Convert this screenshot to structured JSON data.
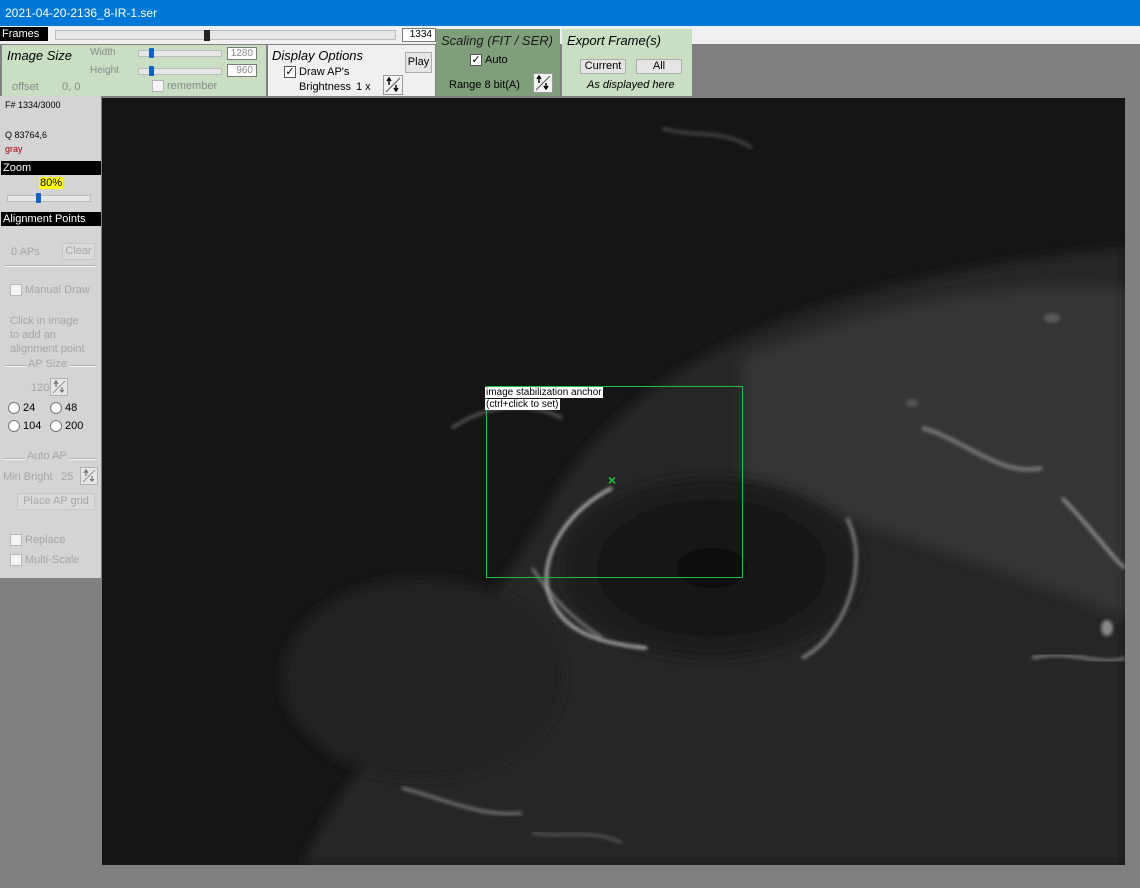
{
  "window": {
    "title": "2021-04-20-2136_8-IR-1.ser"
  },
  "frames": {
    "label": "Frames",
    "value": "1334",
    "position": 0.4446
  },
  "image_size": {
    "title": "Image Size",
    "width_label": "Width",
    "width_value": "1280",
    "height_label": "Height",
    "height_value": "960",
    "remember_label": "remember",
    "offset_label": "offset",
    "offset_value": "0, 0"
  },
  "display_options": {
    "title": "Display Options",
    "draw_aps_label": "Draw AP's",
    "draw_aps_checked": true,
    "brightness_label": "Brightness",
    "brightness_value": "1 x",
    "play_label": "Play"
  },
  "scaling": {
    "title": "Scaling (FIT / SER)",
    "auto_label": "Auto",
    "auto_checked": true,
    "range_label": "Range 8 bit(A)"
  },
  "export": {
    "title": "Export Frame(s)",
    "current_label": "Current",
    "all_label": "All",
    "note": "As displayed here"
  },
  "info": {
    "frame_text": "F# 1334/3000",
    "quality_text": "Q  83764,6",
    "color_text": "gray"
  },
  "zoom": {
    "header": "Zoom",
    "value": "80%"
  },
  "alignment": {
    "header": "Alignment Points",
    "aps_count": "0 APs",
    "clear_label": "Clear",
    "manual_draw_label": "Manual Draw",
    "hint_lines": [
      "Click in image",
      "to add an",
      "alignment point"
    ],
    "ap_size_header": "AP Size",
    "ap_size_value": "120",
    "size_options": [
      "24",
      "48",
      "104",
      "200"
    ],
    "auto_ap_header": "Auto AP",
    "min_bright_label": "Min Bright",
    "min_bright_value": "25",
    "place_grid_label": "Place AP grid",
    "replace_label": "Replace",
    "multiscale_label": "Multi-Scale"
  },
  "anchor": {
    "line1": "image stabilization anchor",
    "line2": "(ctrl+click to set)",
    "marker": "×"
  },
  "colors": {
    "titlebar": "#0078d7",
    "panel_green": "#c9dec2",
    "anchor_green": "#22c03a",
    "zoom_highlight": "#ffff00",
    "gray_text": "#a00000"
  }
}
